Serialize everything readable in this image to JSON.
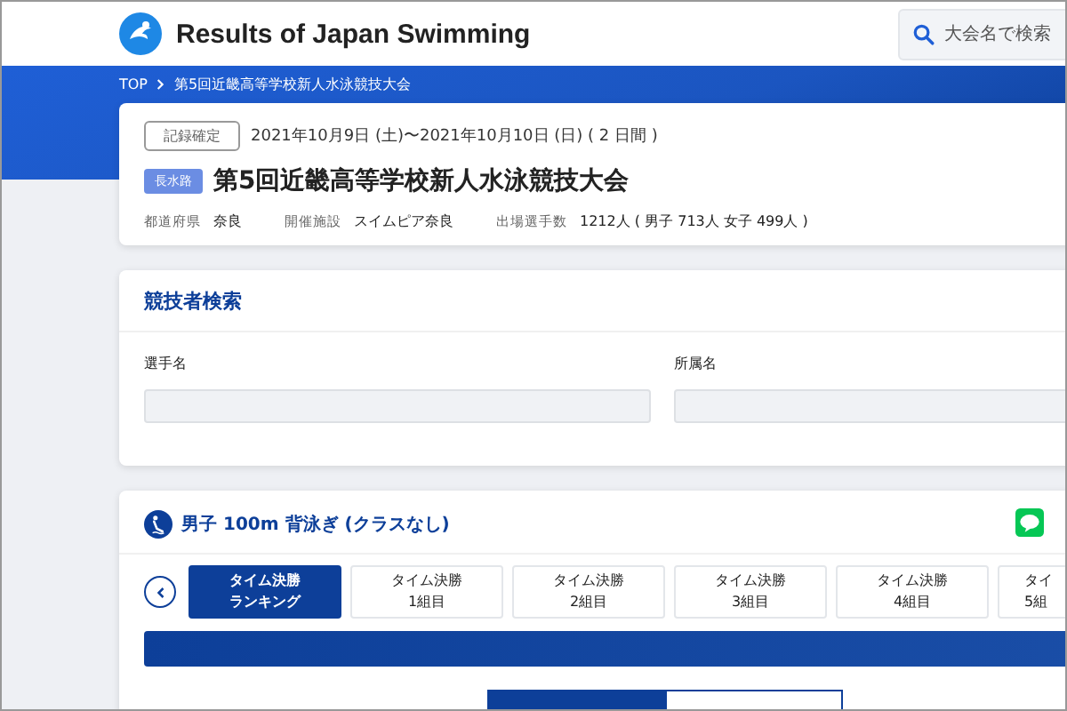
{
  "header": {
    "site_title": "Results of Japan Swimming",
    "search": {
      "placeholder": "大会名で検索"
    }
  },
  "breadcrumb": [
    {
      "label": "TOP"
    },
    {
      "label": "第5回近畿高等学校新人水泳競技大会"
    }
  ],
  "meet": {
    "status": "記録確定",
    "dates": "2021年10月9日 (土)〜2021年10月10日 (日) ( 2 日間 )",
    "course": "長水路",
    "title": "第5回近畿高等学校新人水泳競技大会",
    "details": [
      {
        "label": "都道府県",
        "value": "奈良"
      },
      {
        "label": "開催施設",
        "value": "スイムピア奈良"
      },
      {
        "label": "出場選手数",
        "value": "1212人 ( 男子 713人 女子 499人 )"
      }
    ]
  },
  "athlete_search": {
    "title": "競技者検索",
    "fields": [
      {
        "label": "選手名"
      },
      {
        "label": "所属名"
      }
    ]
  },
  "event": {
    "title": "男子 100m 背泳ぎ (クラスなし)",
    "tabs": [
      {
        "line1": "タイム決勝",
        "line2": "ランキング",
        "selected": true
      },
      {
        "line1": "タイム決勝",
        "line2": "1組目",
        "selected": false
      },
      {
        "line1": "タイム決勝",
        "line2": "2組目",
        "selected": false
      },
      {
        "line1": "タイム決勝",
        "line2": "3組目",
        "selected": false
      },
      {
        "line1": "タイム決勝",
        "line2": "4組目",
        "selected": false
      },
      {
        "line1": "タイ",
        "line2": "5組",
        "selected": false
      }
    ],
    "segments": [
      {
        "selected": true
      },
      {
        "selected": false
      }
    ]
  }
}
